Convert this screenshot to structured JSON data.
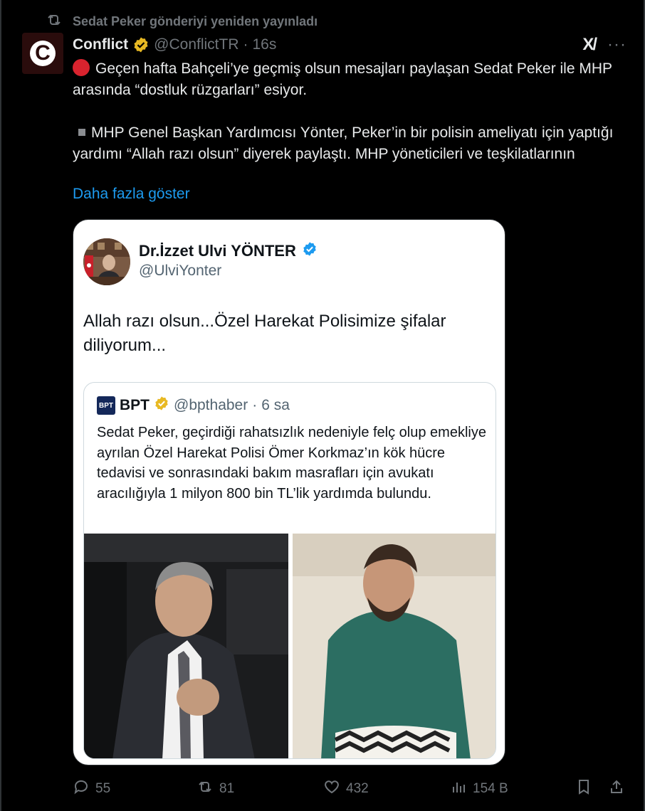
{
  "repost": {
    "label": "Sedat Peker gönderiyi yeniden yayınladı"
  },
  "author": {
    "avatar_letter": "C",
    "name": "Conflict",
    "handle": "@ConflictTR",
    "dot": "·",
    "time": "16s"
  },
  "top_actions": {
    "grok_label": "X/",
    "more_label": "···"
  },
  "post": {
    "para1": "Geçen hafta Bahçeli’ye geçmiş olsun mesajları paylaşan Sedat Peker ile MHP arasında “dostluk rüzgarları” esiyor.",
    "para2": "MHP Genel Başkan Yardımcısı Yönter, Peker’in bir polisin ameliyatı için yaptığı yardımı “Allah razı olsun” diyerek paylaştı. MHP yöneticileri ve teşkilatlarının",
    "show_more": "Daha fazla göster"
  },
  "embed": {
    "name": "Dr.İzzet Ulvi YÖNTER",
    "handle": "@UlviYonter",
    "text": "Allah razı olsun...Özel Harekat Polisimize şifalar diliyorum...",
    "quote": {
      "logo_text": "BPT",
      "name": "BPT",
      "handle": "@bpthaber",
      "dot": "·",
      "time": "6 sa",
      "text": "Sedat Peker, geçirdiği rahatsızlık nedeniyle felç olup emekliye ayrılan Özel Harekat Polisi Ömer Korkmaz’ın kök hücre tedavisi ve sonrasındaki bakım masrafları için avukatı aracılığıyla 1 milyon 800 bin TL’lik yardımda bulundu."
    }
  },
  "stats": {
    "replies": "55",
    "reposts": "81",
    "likes": "432",
    "views": "154 B"
  },
  "colors": {
    "background": "#000000",
    "text": "#e7e9ea",
    "muted": "#71767b",
    "link": "#1d9bf0",
    "verified_gold": "#e8b923",
    "verified_blue": "#1d9bf0",
    "red_circle": "#d9232e"
  }
}
